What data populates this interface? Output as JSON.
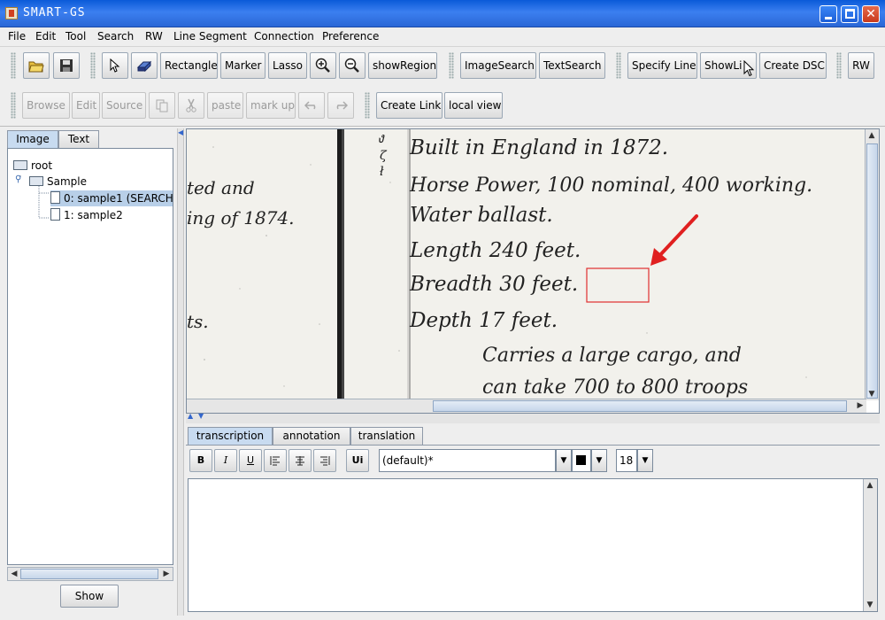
{
  "window": {
    "title": "SMART-GS"
  },
  "menu": [
    "File",
    "Edit",
    "Tool",
    "Search",
    "RW",
    "Line Segment",
    "Connection",
    "Preference"
  ],
  "toolbar": {
    "rectangle": "Rectangle",
    "marker": "Marker",
    "lasso": "Lasso",
    "show_region": "showRegion",
    "image_search": "ImageSearch",
    "text_search": "TextSearch",
    "specify_line": "Specify Line",
    "show_line": "ShowLi",
    "create_dsc": "Create DSC",
    "rw": "RW",
    "browse": "Browse",
    "edit": "Edit",
    "source": "Source",
    "paste": "paste",
    "mark_up": "mark up",
    "create_link": "Create Link",
    "local_view": "local view"
  },
  "left_panel": {
    "tabs": [
      "Image",
      "Text"
    ],
    "tree": {
      "root": "root",
      "folder": "Sample",
      "items": [
        "0: sample1 (SEARCH",
        "1: sample2"
      ]
    },
    "show_button": "Show"
  },
  "document_image": {
    "left_col": [
      "ted and",
      "ing of 1874."
    ],
    "lines": [
      "Built in England in 1872.",
      "Horse Power, 100 nominal, 400 working.",
      "Water ballast.",
      "Length 240 feet.",
      "Breadth 30 feet.",
      "Depth 17 feet.",
      "Carries a large cargo, and",
      "can take 700 to 800 troops"
    ],
    "highlight_color": "#e03030"
  },
  "editor": {
    "tabs": [
      "transcription",
      "annotation",
      "translation"
    ],
    "bold": "B",
    "italic": "I",
    "underline": "U",
    "unicode": "Ui",
    "font_family": "(default)*",
    "font_size": "18",
    "text": ""
  }
}
